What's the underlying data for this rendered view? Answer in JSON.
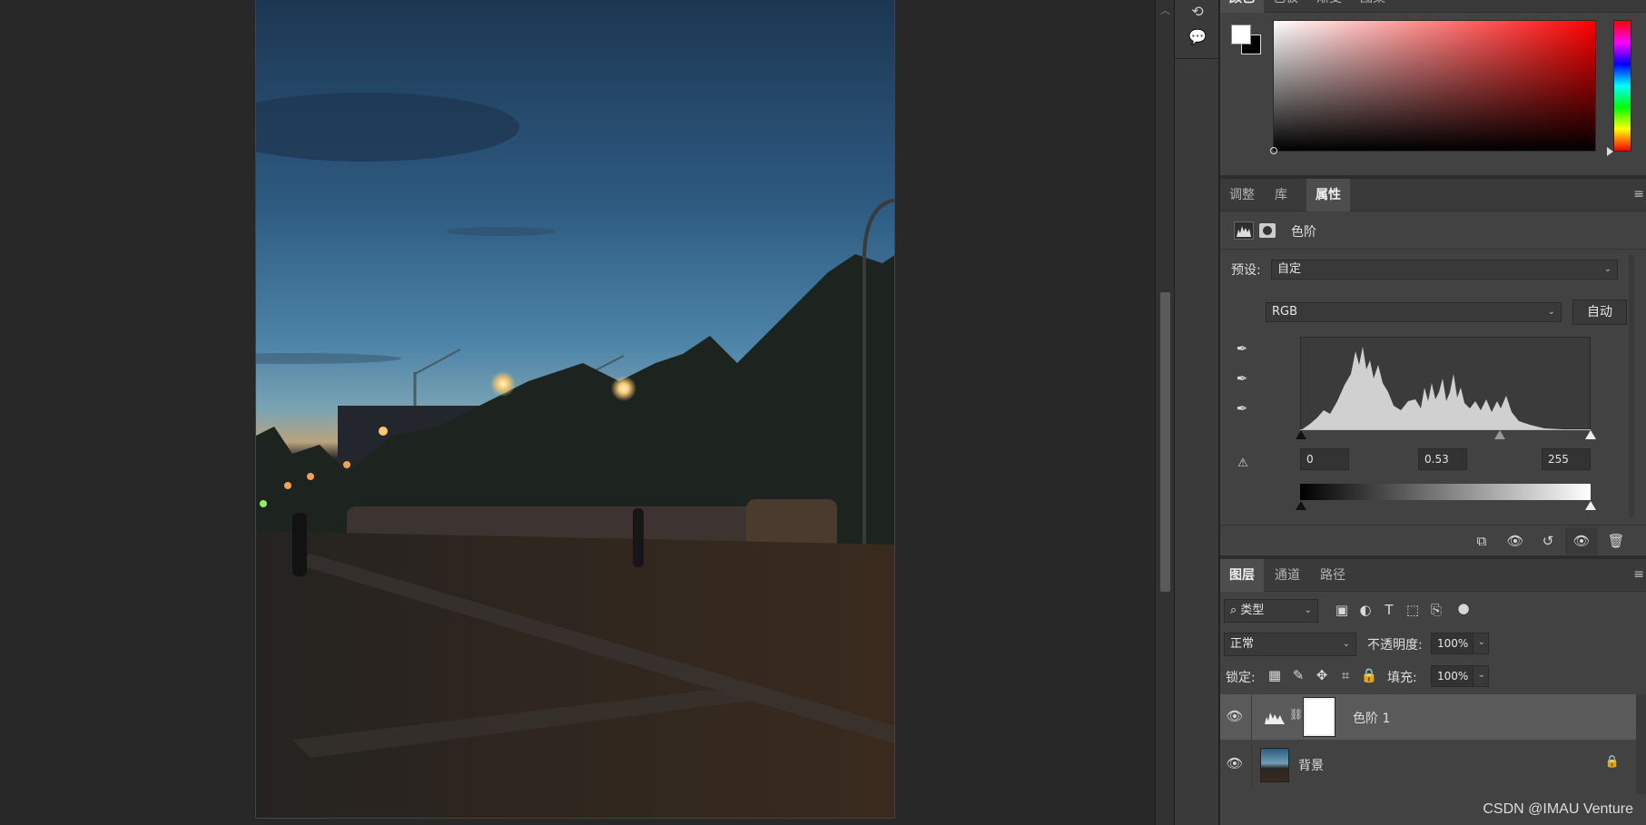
{
  "color_panel": {
    "tabs": [
      "颜色",
      "色板",
      "渐变",
      "图案"
    ],
    "foreground_color": "#ffffff",
    "background_color": "#000000",
    "picker_hue": "#ff0000"
  },
  "properties_panel": {
    "tabs": [
      "调整",
      "库",
      "属性"
    ],
    "active_tab": "属性",
    "adjustment_title": "色阶",
    "preset_label": "预设:",
    "preset_value": "自定",
    "channel_value": "RGB",
    "auto_button": "自动",
    "input_levels": {
      "black": "0",
      "gamma": "0.53",
      "white": "255"
    },
    "output_levels": {
      "black": "0",
      "white": "255"
    }
  },
  "layers_panel": {
    "tabs": [
      "图层",
      "通道",
      "路径"
    ],
    "active_tab": "图层",
    "filter_kind": "类型",
    "blend_mode": "正常",
    "opacity_label": "不透明度:",
    "opacity_value": "100%",
    "lock_label": "锁定:",
    "fill_label": "填充:",
    "fill_value": "100%",
    "layers": [
      {
        "name": "色阶 1",
        "type": "adjustment",
        "selected": true
      },
      {
        "name": "背景",
        "type": "background",
        "locked": true
      }
    ]
  },
  "watermark": "CSDN @IMAU Venture"
}
